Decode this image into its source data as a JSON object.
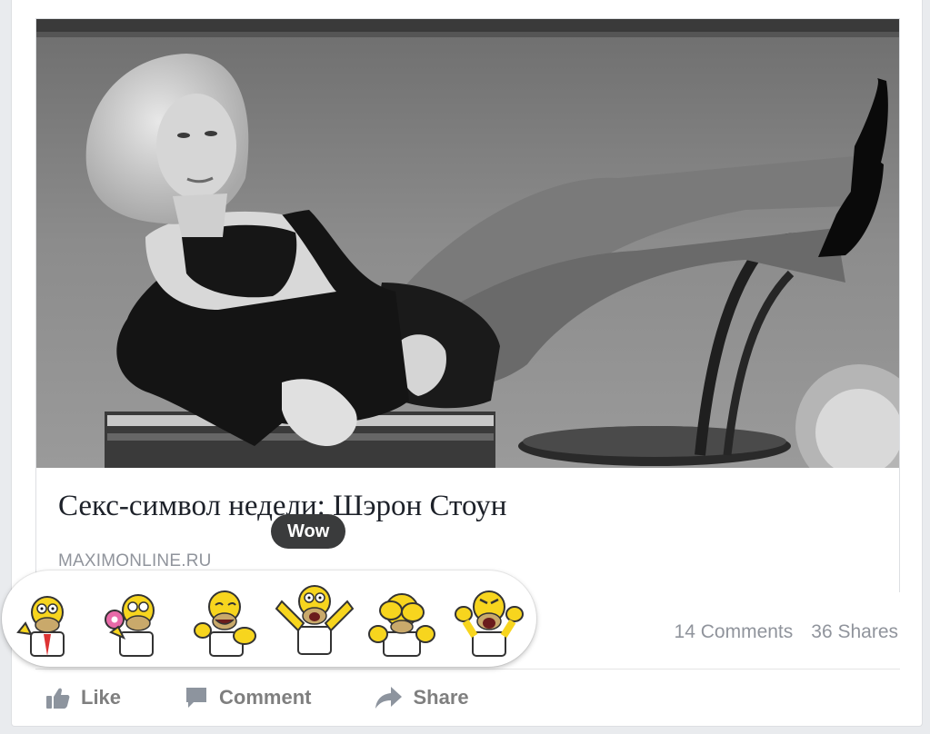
{
  "post": {
    "link_title": "Секс-символ недели: Шэрон Стоун",
    "link_domain": "MAXIMONLINE.RU",
    "comments": "14 Comments",
    "shares": "36 Shares"
  },
  "actions": {
    "like": "Like",
    "comment": "Comment",
    "share": "Share"
  },
  "reactions": {
    "tooltip": "Wow",
    "items": [
      "homer-like-icon",
      "homer-love-icon",
      "homer-haha-icon",
      "homer-wow-icon",
      "homer-sad-icon",
      "homer-angry-icon"
    ]
  },
  "colors": {
    "skin": "#f7d51e",
    "muted_text": "#90949c",
    "title_text": "#1d2129"
  }
}
